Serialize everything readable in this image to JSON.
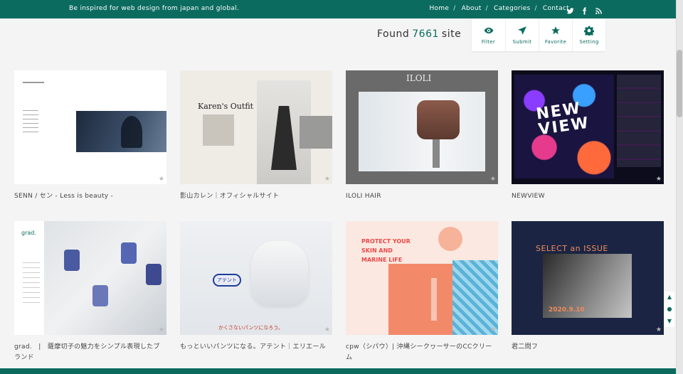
{
  "header": {
    "tagline": "Be inspired for web design from japan and global.",
    "nav": [
      {
        "label": "Home",
        "sep": "/"
      },
      {
        "label": "About",
        "sep": "/"
      },
      {
        "label": "Categories",
        "sep": "/"
      },
      {
        "label": "Contact",
        "sep": ""
      }
    ],
    "social": [
      "twitter-icon",
      "facebook-icon",
      "rss-icon"
    ]
  },
  "found": {
    "prefix": "Found",
    "count": "7661",
    "suffix": "site"
  },
  "tools": [
    {
      "label": "Filter",
      "icon": "eye-icon"
    },
    {
      "label": "Submit",
      "icon": "paper-plane-icon"
    },
    {
      "label": "Favorite",
      "icon": "star-icon"
    },
    {
      "label": "Setting",
      "icon": "gear-icon"
    }
  ],
  "cards": [
    {
      "caption": "SENN / セン - Less is beauty -"
    },
    {
      "caption": "影山カレン｜オフィシャルサイト",
      "thumb_title": "Karen's Outfit"
    },
    {
      "caption": "ILOLI HAIR",
      "thumb_title": "ILOLI"
    },
    {
      "caption": "NEWVIEW",
      "thumb_title": "NEW VIEW"
    },
    {
      "caption": "grad.　|　薩摩切子の魅力をシンプル表現したブランド",
      "thumb_title": "grad."
    },
    {
      "caption": "もっといいパンツになる。アテント｜エリエール",
      "thumb_title": "アテント",
      "thumb_subtitle": "かくさないパンツになろう。"
    },
    {
      "caption": "cpw（シパウ）| 沖縄シークヮーサーのCCクリーム",
      "thumb_title": "PROTECT YOUR SKIN AND MARINE LIFE"
    },
    {
      "caption": "君二問フ",
      "thumb_title": "SELECT an ISSUE",
      "thumb_date": "2020.9.10"
    }
  ],
  "colors": {
    "brand": "#0c6b5f",
    "background": "#f4f4f4"
  }
}
